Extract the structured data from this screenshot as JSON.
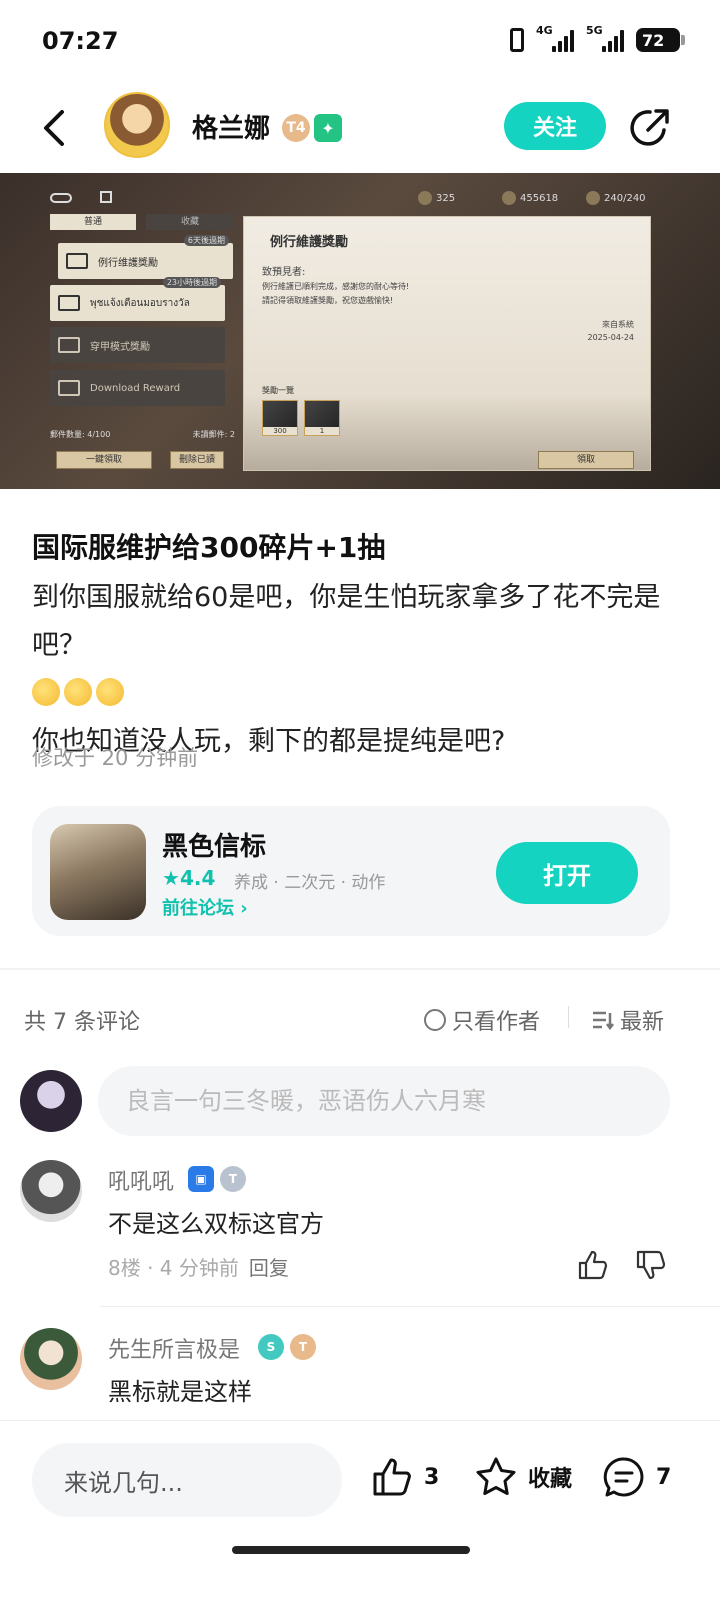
{
  "status": {
    "time": "07:27",
    "net1": "4G",
    "net2": "5G",
    "battery": "72"
  },
  "header": {
    "author_name": "格兰娜",
    "badge_level": "T4",
    "follow_label": "关注"
  },
  "post_image": {
    "tab_normal": "普通",
    "tab_favorite": "收藏",
    "res1": "325",
    "res2": "455618",
    "res3": "240/240",
    "mails": [
      {
        "label": "例行维護獎勵",
        "tag": "6天後過期"
      },
      {
        "label": "พุชแจ้งเตือนมอบรางวัล",
        "tag": "23小時後過期"
      },
      {
        "label": "穿甲模式獎勵",
        "tag": ""
      },
      {
        "label": "Download Reward",
        "tag": ""
      }
    ],
    "panel_title": "例行維護獎勵",
    "panel_greeting": "致預見者:",
    "panel_line1": "例行維護已順利完成，感謝您的耐心等待!",
    "panel_line2": "請記得領取維護獎勵，祝您遊戲愉快!",
    "panel_sender": "來自系統",
    "panel_date": "2025-04-24",
    "panel_rewards": "獎勵一覽",
    "item1_qty": "300",
    "item2_qty": "1",
    "mail_count": "郵件數量: 4/100",
    "unread": "未讀郵件: 2",
    "btn_claim_all": "一鍵領取",
    "btn_delete_read": "刪除已讀",
    "btn_claim": "領取"
  },
  "post": {
    "title": "国际服维护给300碎片+1抽",
    "line1": "到你国服就给60是吧，你是生怕玩家拿多了花不完是吧？",
    "line2": "你也知道没人玩，剩下的都是提纯是吧?",
    "edited": "修改于 20 分钟前"
  },
  "game_card": {
    "name": "黑色信标",
    "rating": "4.4",
    "tags": "养成 · 二次元 · 动作",
    "forum_link": "前往论坛",
    "open_label": "打开"
  },
  "comments_header": {
    "count": "共 7 条评论",
    "author_only": "只看作者",
    "sort": "最新"
  },
  "comment_input": {
    "placeholder": "良言一句三冬暖，恶语伤人六月寒"
  },
  "comments": [
    {
      "user": "吼吼吼",
      "text": "不是这么双标这官方",
      "floor": "8楼 · 4 分钟前",
      "reply": "回复"
    },
    {
      "user": "先生所言极是",
      "text": "黑标就是这样"
    }
  ],
  "bottom_bar": {
    "placeholder": "来说几句...",
    "likes": "3",
    "favorite_label": "收藏",
    "comments": "7"
  },
  "colors": {
    "accent": "#14d3c0",
    "accent_text": "#10c2ad"
  }
}
